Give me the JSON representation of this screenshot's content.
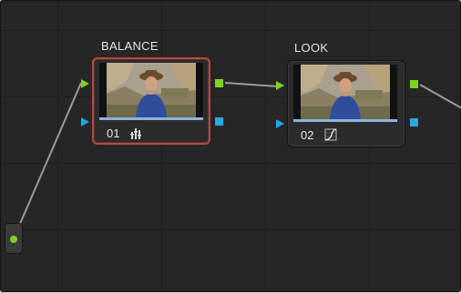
{
  "nodes": [
    {
      "title": "BALANCE",
      "number": "01",
      "tool_icon": "color-wheels-icon",
      "selected": true
    },
    {
      "title": "LOOK",
      "number": "02",
      "tool_icon": "curves-icon",
      "selected": false
    }
  ],
  "source": {
    "icon": "source-output-icon"
  },
  "colors": {
    "rgb_port": "#7ed321",
    "alpha_port": "#1ea6e6",
    "selected_outline": "#c8423a",
    "connection_line": "#9a9a9a"
  }
}
